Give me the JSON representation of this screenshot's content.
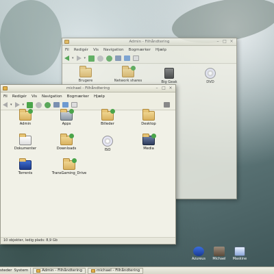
{
  "admin_window": {
    "title": "Admin - Filhåndtering",
    "menu": [
      "Fil",
      "Redigér",
      "Vis",
      "Navigation",
      "Bogmærker",
      "Hjælp"
    ],
    "items": [
      {
        "label": "Brugere",
        "icon": "folder-icon"
      },
      {
        "label": "Network shares",
        "icon": "folder-network-icon"
      },
      {
        "label": "Big Geak",
        "icon": "hard-disk-icon"
      },
      {
        "label": "DVD",
        "icon": "dvd-drive-icon"
      }
    ]
  },
  "michael_window": {
    "title": "michael - Filhåndtering",
    "menu": [
      "Fil",
      "Redigér",
      "Vis",
      "Navigation",
      "Bogmærker",
      "Hjælp"
    ],
    "items": [
      {
        "label": "Admin",
        "icon": "folder-icon"
      },
      {
        "label": "Apps",
        "icon": "applications-icon"
      },
      {
        "label": "Billeder",
        "icon": "pictures-folder-icon"
      },
      {
        "label": "Desktop",
        "icon": "desktop-folder-icon"
      },
      {
        "label": "Dokumenter",
        "icon": "documents-icon"
      },
      {
        "label": "Downloads",
        "icon": "downloads-folder-icon"
      },
      {
        "label": "ISO",
        "icon": "disc-image-icon"
      },
      {
        "label": "Media",
        "icon": "media-icon"
      },
      {
        "label": "Torrents",
        "icon": "torrents-icon"
      },
      {
        "label": "TransGaming_Drive",
        "icon": "folder-icon"
      }
    ],
    "status": "10 objekter, ledig plads: 8,9 Gb"
  },
  "desktop_icons": [
    {
      "label": "Azureus",
      "icon": "azureus-frog-icon"
    },
    {
      "label": "Michael",
      "icon": "home-icon"
    },
    {
      "label": "Maskine",
      "icon": "computer-icon"
    }
  ],
  "panel": {
    "places_label": "steder",
    "system_label": "System",
    "tasks": [
      "Admin - Filhåndtering",
      "michael - Filhåndtering"
    ]
  }
}
